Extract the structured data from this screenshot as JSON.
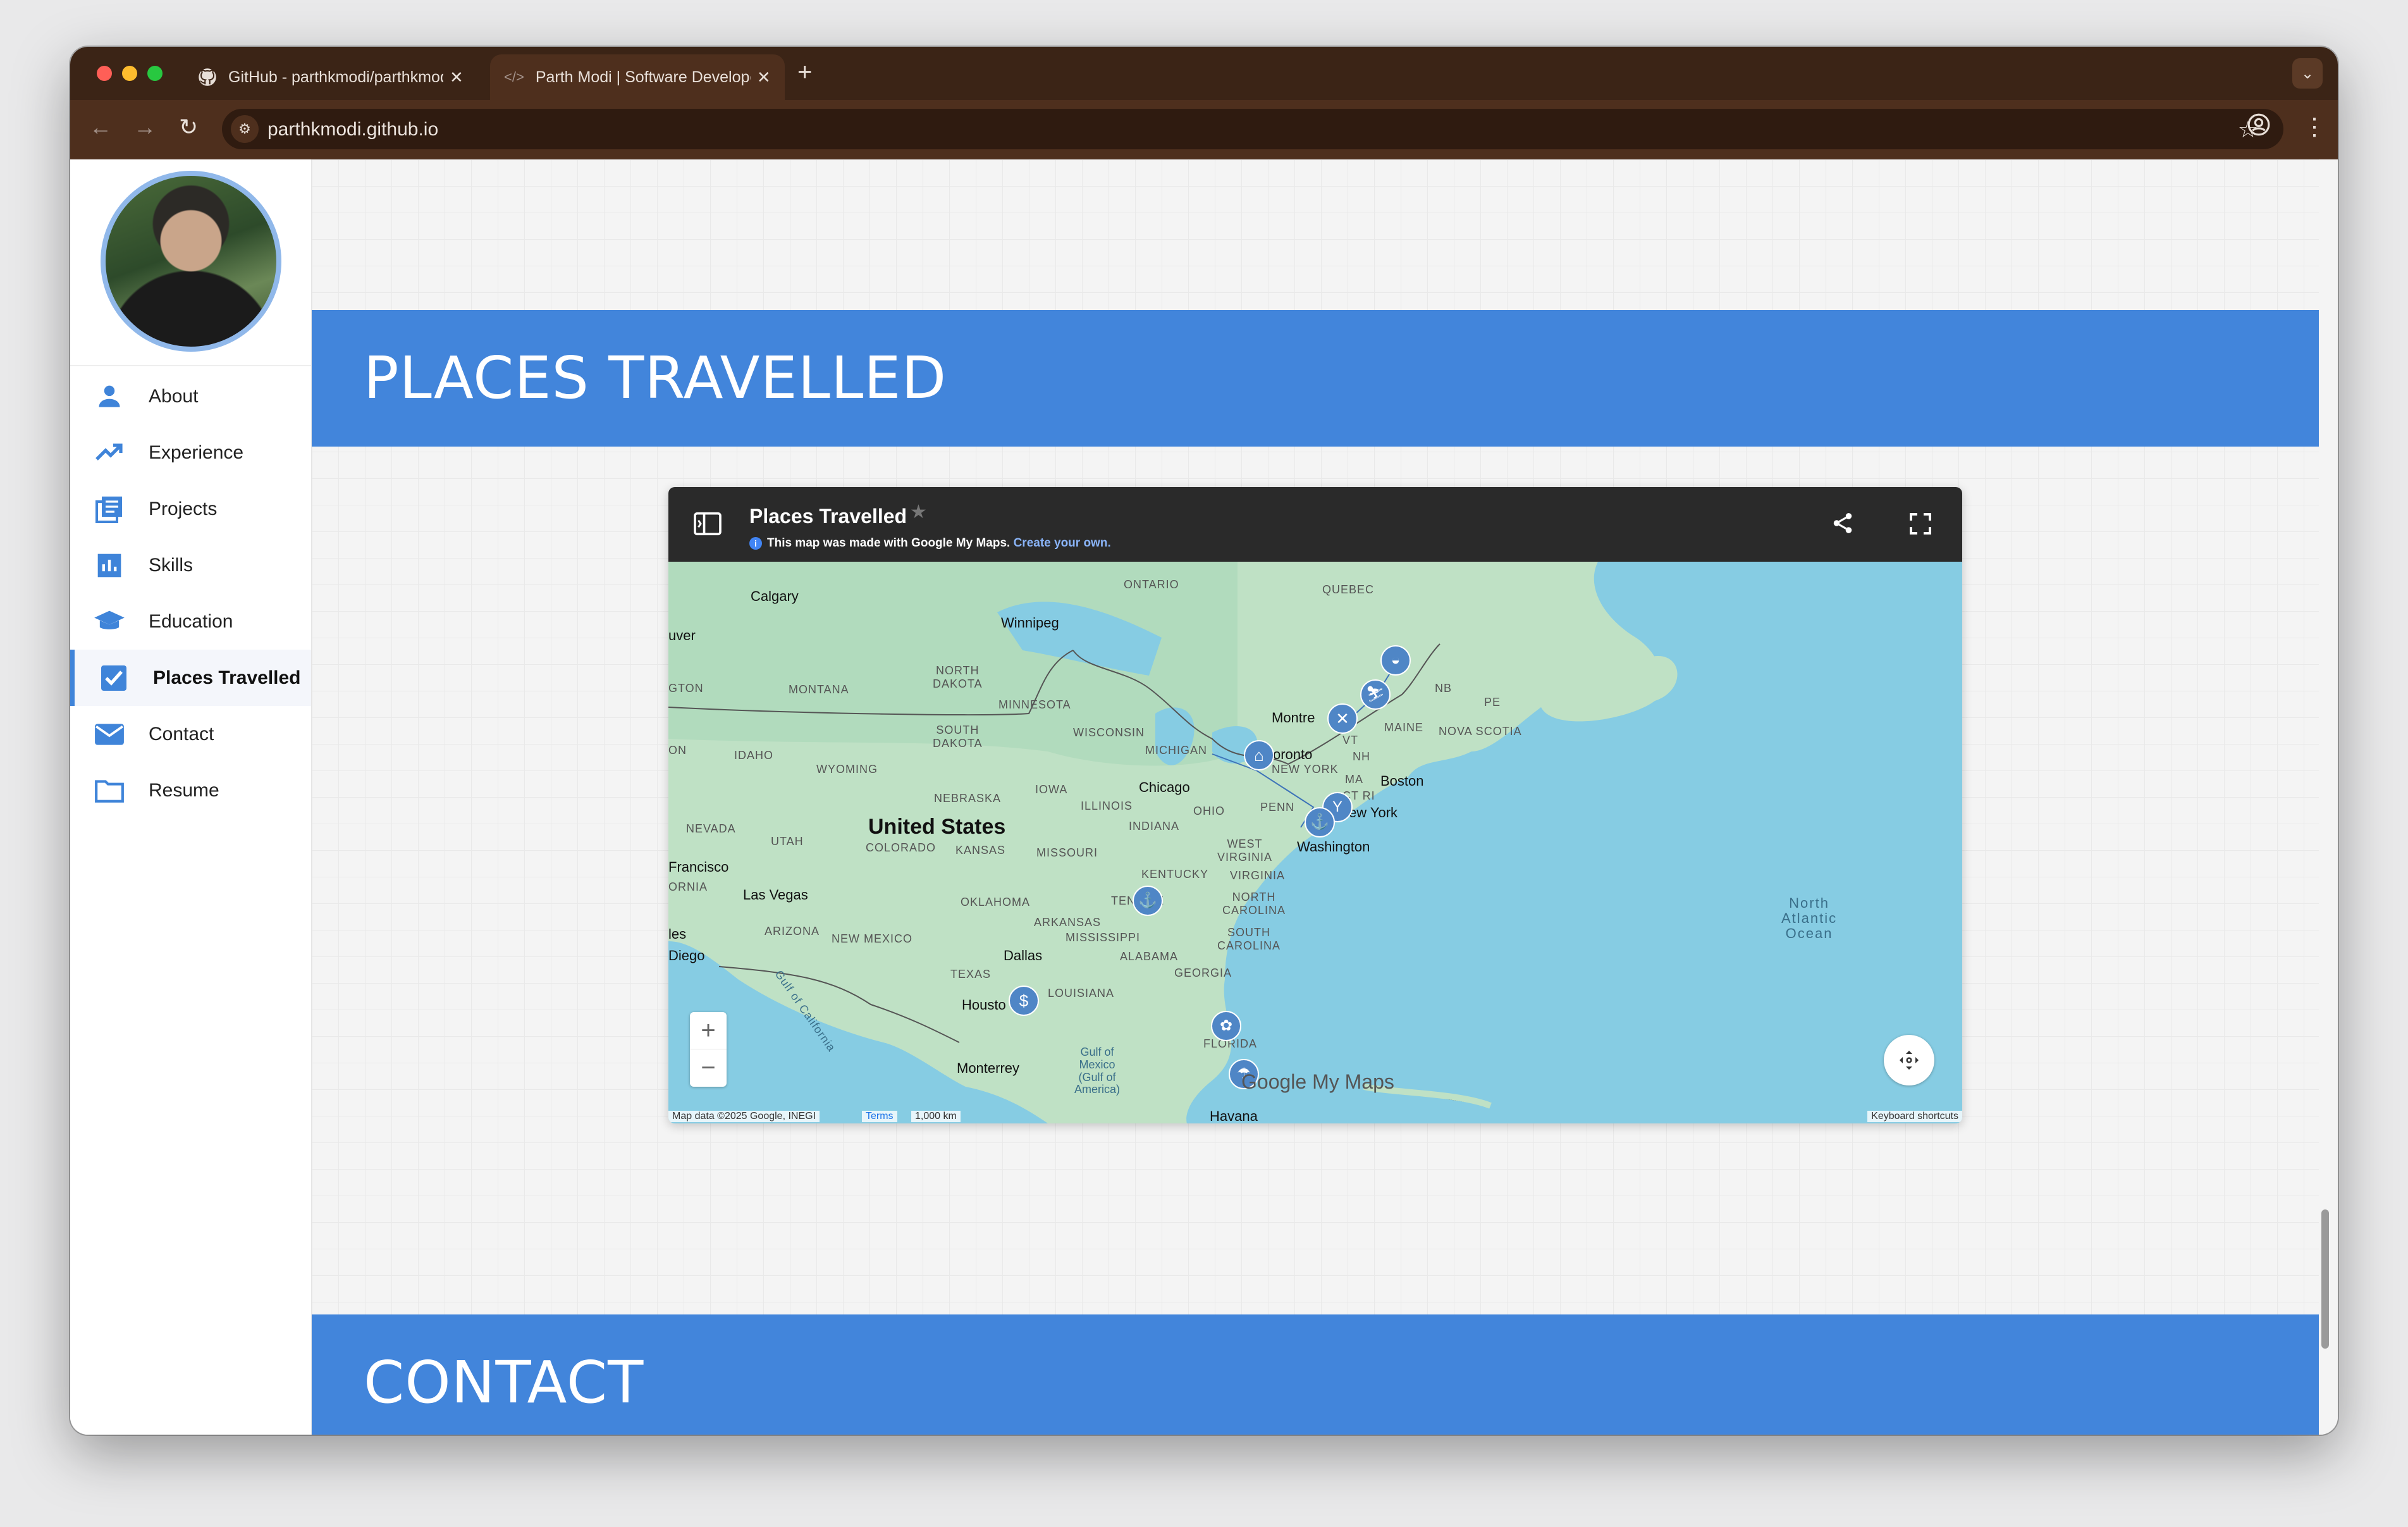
{
  "browser": {
    "tabs": [
      {
        "title": "GitHub - parthkmodi/parthkmodi.github.io",
        "active": false
      },
      {
        "title": "Parth Modi | Software Developer",
        "active": true
      }
    ],
    "url": "parthkmodi.github.io",
    "new_tab": "+",
    "close": "✕"
  },
  "sidebar": {
    "items": [
      {
        "label": "About",
        "icon": "person-icon",
        "active": false
      },
      {
        "label": "Experience",
        "icon": "trending-up-icon",
        "active": false
      },
      {
        "label": "Projects",
        "icon": "projects-icon",
        "active": false
      },
      {
        "label": "Skills",
        "icon": "bar-chart-icon",
        "active": false
      },
      {
        "label": "Education",
        "icon": "graduation-cap-icon",
        "active": false
      },
      {
        "label": "Places Travelled",
        "icon": "checkbox-icon",
        "active": true
      },
      {
        "label": "Contact",
        "icon": "mail-icon",
        "active": false
      },
      {
        "label": "Resume",
        "icon": "folder-icon",
        "active": false
      }
    ]
  },
  "sections": {
    "places_title": "PLACES TRAVELLED",
    "contact_title": "CONTACT"
  },
  "map": {
    "title": "Places Travelled",
    "info_text": "This map was made with Google My Maps.",
    "info_link": "Create your own.",
    "logo_text": "Google My Maps",
    "attribution": "Map data ©2025 Google, INEGI",
    "terms": "Terms",
    "scale": "1,000 km",
    "shortcuts": "Keyboard shortcuts",
    "labels": {
      "ontario": "ONTARIO",
      "quebec": "QUEBEC",
      "calgary": "Calgary",
      "winnipeg": "Winnipeg",
      "vancouver": "uver",
      "north_dakota": "NORTH\nDAKOTA",
      "montana": "MONTANA",
      "minnesota": "MINNESOTA",
      "washington_state": "GTON",
      "south_dakota": "SOUTH\nDAKOTA",
      "wisconsin": "WISCONSIN",
      "michigan": "MICHIGAN",
      "idaho": "IDAHO",
      "wyoming": "WYOMING",
      "oregon": "ON",
      "montreal": "Montre",
      "toronto": "oronto",
      "vt": "VT",
      "maine": "MAINE",
      "nb": "NB",
      "pe": "PE",
      "nova_scotia": "NOVA SCOTIA",
      "new_york_state": "NEW YORK",
      "nh": "NH",
      "ma": "MA",
      "boston": "Boston",
      "ct_ri": "CT RI",
      "new_york": "ew York",
      "nebraska": "NEBRASKA",
      "iowa": "IOWA",
      "chicago": "Chicago",
      "illinois": "ILLINOIS",
      "ohio": "OHIO",
      "penn": "PENN",
      "indiana": "INDIANA",
      "nevada": "NEVADA",
      "utah": "UTAH",
      "united_states": "United States",
      "colorado": "COLORADO",
      "kansas": "KANSAS",
      "missouri": "MISSOURI",
      "west_virginia": "WEST\nVIRGINIA",
      "washington_dc": "Washington",
      "san_francisco": "Francisco",
      "california": "ORNIA",
      "las_vegas": "Las Vegas",
      "kentucky": "KENTUCKY",
      "virginia": "VIRGINIA",
      "oklahoma": "OKLAHOMA",
      "tennessee": "TEN    SEE",
      "north_carolina": "NORTH\nCAROLINA",
      "los_angeles": "les",
      "arizona": "ARIZONA",
      "arkansas": "ARKANSAS",
      "new_mexico": "NEW MEXICO",
      "mississippi": "MISSISSIPPI",
      "south_carolina": "SOUTH\nCAROLINA",
      "san_diego": "Diego",
      "dallas": "Dallas",
      "alabama": "ALABAMA",
      "georgia": "GEORGIA",
      "texas": "TEXAS",
      "louisiana": "LOUISIANA",
      "houston": "Housto",
      "florida": "FLORIDA",
      "gulf_california": "Gulf of California",
      "monterrey": "Monterrey",
      "gulf_mexico": "Gulf of\nMexico\n(Gulf of\nAmerica)",
      "north_atlantic": "North\nAtlantic\nOcean",
      "havana": "Havana"
    }
  },
  "colors": {
    "accent": "#4285db",
    "tab_strip": "#3b2416",
    "toolbar": "#4e2f1d",
    "water": "#86cce3",
    "land": "#bfe1c5",
    "marker": "#4f86c6"
  }
}
